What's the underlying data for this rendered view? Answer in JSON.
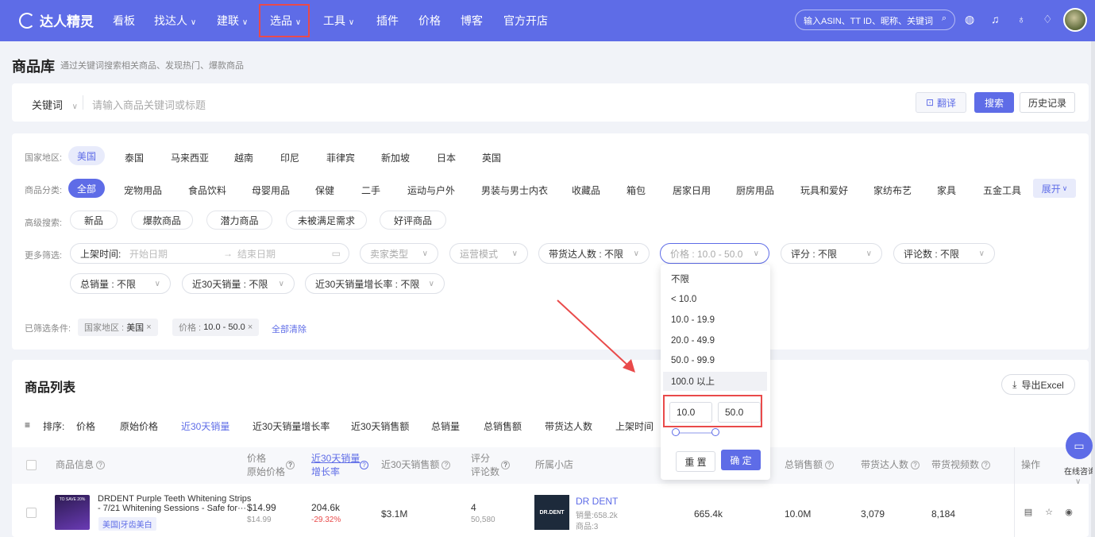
{
  "brand": {
    "name": "达人精灵"
  },
  "nav": {
    "items": [
      "看板",
      "找达人",
      "建联",
      "选品",
      "工具",
      "插件",
      "价格",
      "博客",
      "官方开店"
    ],
    "search_placeholder": "输入ASIN、TT ID、昵称、关键词"
  },
  "page": {
    "title": "商品库",
    "subtitle": "通过关键词搜索相关商品、发现热门、爆款商品"
  },
  "search": {
    "keyword_type": "关键词",
    "placeholder": "请输入商品关键词或标题",
    "translate_label": "翻译",
    "search_label": "搜索",
    "history_label": "历史记录"
  },
  "filters": {
    "region_label": "国家地区:",
    "regions": [
      "美国",
      "泰国",
      "马来西亚",
      "越南",
      "印尼",
      "菲律宾",
      "新加坡",
      "日本",
      "英国"
    ],
    "category_label": "商品分类:",
    "categories": [
      "全部",
      "宠物用品",
      "食品饮料",
      "母婴用品",
      "保健",
      "二手",
      "运动与户外",
      "男装与男士内衣",
      "收藏品",
      "箱包",
      "居家日用",
      "厨房用品",
      "玩具和爱好",
      "家纺布艺",
      "家具",
      "五金工具"
    ],
    "expand_label": "展开",
    "advanced_label": "高级搜索:",
    "advanced": [
      "新品",
      "爆款商品",
      "潜力商品",
      "未被满足需求",
      "好评商品"
    ],
    "more_label": "更多筛选:",
    "listing_time_label": "上架时间:",
    "start_placeholder": "开始日期",
    "end_placeholder": "结束日期",
    "seller_type": "卖家类型",
    "ops_mode": "运营模式",
    "creators": "带货达人数 : 不限",
    "price": "价格 : 10.0 - 50.0",
    "rating": "评分 : 不限",
    "reviews": "评论数 : 不限",
    "total_sales": "总销量 : 不限",
    "sales_30d": "近30天销量 : 不限",
    "growth_30d": "近30天销量增长率 : 不限",
    "applied_label": "已筛选条件:",
    "chip_region_key": "国家地区 :",
    "chip_region_val": "美国",
    "chip_price_key": "价格 :",
    "chip_price_val": "10.0 - 50.0",
    "clear_all": "全部清除"
  },
  "list": {
    "title": "商品列表",
    "export_label": "导出Excel",
    "sort_label": "排序:",
    "sort_options": [
      "价格",
      "原始价格",
      "近30天销量",
      "近30天销量增长率",
      "近30天销售额",
      "总销量",
      "总销售额",
      "带货达人数",
      "上架时间"
    ],
    "columns": {
      "product": "商品信息",
      "price": "价格",
      "orig_price": "原始价格",
      "sales30": "近30天销量",
      "growth": "增长率",
      "revenue30": "近30天销售额",
      "rating": "评分",
      "review_count": "评论数",
      "shop": "所属小店",
      "total_revenue": "总销售额",
      "creators": "带货达人数",
      "videos": "带货视频数",
      "actions": "操作"
    },
    "rows": [
      {
        "thumb_text": "TO SAVE 20%",
        "title_line1": "DRDENT Purple Teeth Whitening Strips",
        "title_line2": "- 7/21 Whitening Sessions - Safe for···",
        "tag": "美国|牙齿美白",
        "price": "$14.99",
        "orig_price": "$14.99",
        "sales30": "204.6k",
        "growth": "-29.32%",
        "revenue30": "$3.1M",
        "rating": "4",
        "reviews": "50,580",
        "shop_logo": "DR.DENT",
        "shop_name": "DR DENT",
        "shop_sales": "销量:658.2k",
        "shop_products": "商品:3",
        "total_sales": "665.4k",
        "total_revenue": "10.0M",
        "creators": "3,079",
        "videos": "8,184"
      }
    ]
  },
  "price_popup": {
    "options": [
      "不限",
      "< 10.0",
      "10.0 - 19.9",
      "20.0 - 49.9",
      "50.0 - 99.9",
      "100.0 以上"
    ],
    "min_value": "10.0",
    "max_value": "50.0",
    "reset_label": "重 置",
    "confirm_label": "确 定"
  },
  "float_chat": {
    "label": "在线咨询"
  },
  "colors": {
    "primary": "#5e6ce7",
    "highlight_red": "#e94a4a",
    "negative": "#e94a4a"
  }
}
